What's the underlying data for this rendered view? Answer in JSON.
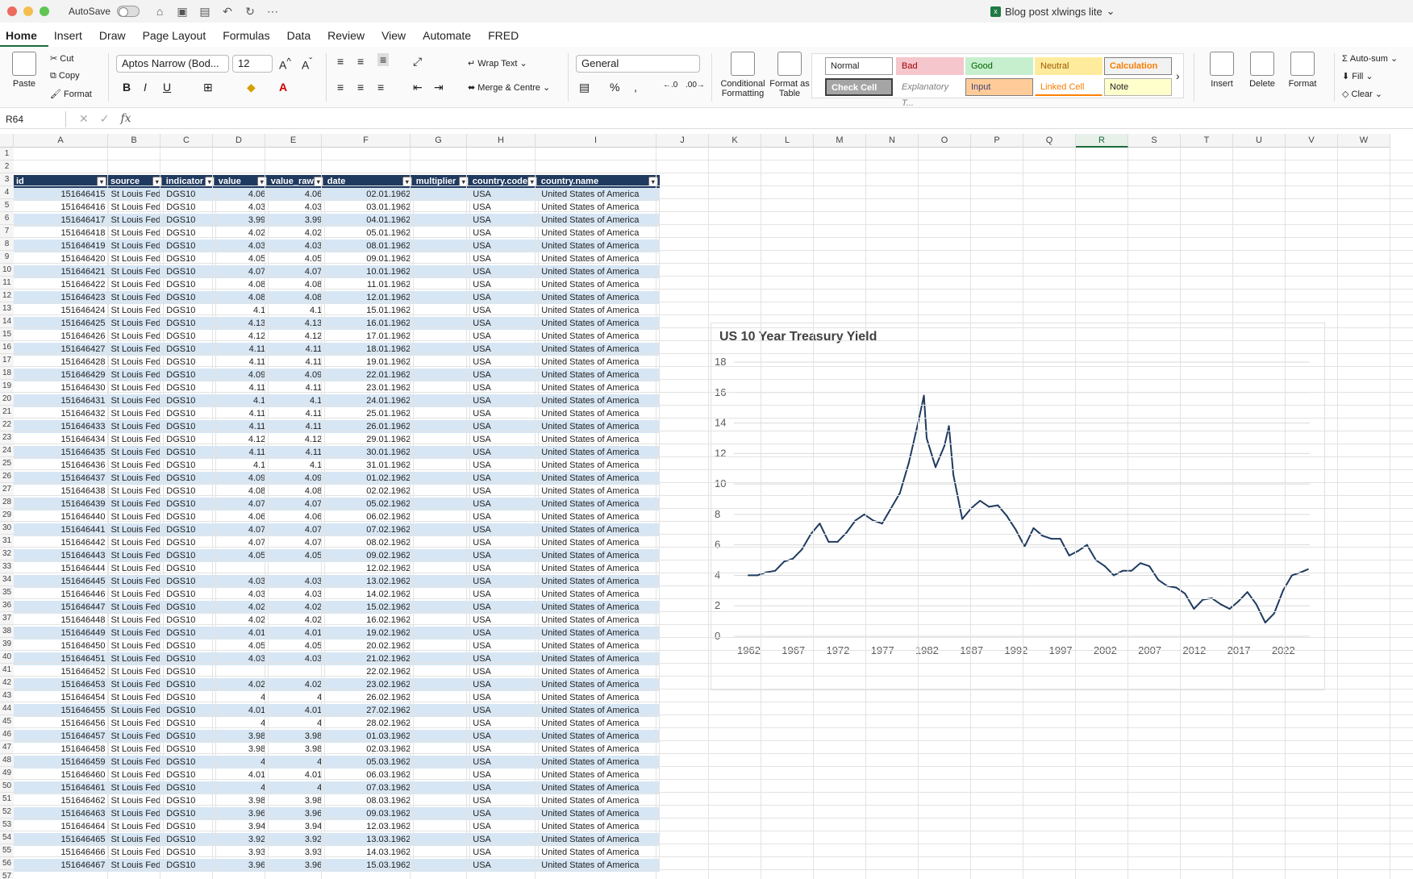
{
  "window": {
    "autosave_label": "AutoSave",
    "doc_title": "Blog post xlwings lite"
  },
  "tabs": [
    "Home",
    "Insert",
    "Draw",
    "Page Layout",
    "Formulas",
    "Data",
    "Review",
    "View",
    "Automate",
    "FRED"
  ],
  "ribbon": {
    "paste": "Paste",
    "cut": "Cut",
    "copy": "Copy",
    "format_painter": "Format",
    "font_name": "Aptos Narrow (Bod...",
    "font_size": "12",
    "wrap_text": "Wrap Text",
    "merge_center": "Merge & Centre",
    "number_format": "General",
    "conditional_formatting": "Conditional Formatting",
    "format_as_table": "Format as Table",
    "styles": [
      "Normal",
      "Bad",
      "Good",
      "Neutral",
      "Calculation",
      "Check Cell",
      "Explanatory T...",
      "Input",
      "Linked Cell",
      "Note"
    ],
    "insert": "Insert",
    "delete": "Delete",
    "format": "Format",
    "autosum": "Auto-sum",
    "fill": "Fill",
    "clear": "Clear"
  },
  "formula_bar": {
    "name_box": "R64",
    "fx": "fx"
  },
  "columns": [
    "A",
    "B",
    "C",
    "D",
    "E",
    "F",
    "G",
    "H",
    "I",
    "J",
    "K",
    "L",
    "M",
    "N",
    "O",
    "P",
    "Q",
    "R",
    "S",
    "T",
    "U",
    "V",
    "W"
  ],
  "selected_column": "R",
  "rows": [
    "1",
    "2",
    "3",
    "4",
    "5",
    "6",
    "7",
    "8",
    "9",
    "10",
    "11",
    "12",
    "13",
    "14",
    "15",
    "16",
    "17",
    "18",
    "19",
    "20",
    "21",
    "22",
    "23",
    "24",
    "25",
    "26",
    "27",
    "28",
    "29",
    "30",
    "31",
    "32",
    "33",
    "34",
    "35",
    "36",
    "37",
    "38",
    "39",
    "40",
    "41",
    "42",
    "43",
    "44",
    "45",
    "46",
    "47",
    "48",
    "49",
    "50",
    "51",
    "52",
    "53",
    "54",
    "55",
    "56",
    "57"
  ],
  "table": {
    "headers": [
      "id",
      "source",
      "indicator",
      "value",
      "value_raw",
      "date",
      "multiplier",
      "country.code",
      "country.name"
    ],
    "rows": [
      [
        "151646415",
        "St Louis Fed",
        "DGS10",
        "4.06",
        "4.06",
        "02.01.1962",
        "",
        "USA",
        "United States of America"
      ],
      [
        "151646416",
        "St Louis Fed",
        "DGS10",
        "4.03",
        "4.03",
        "03.01.1962",
        "",
        "USA",
        "United States of America"
      ],
      [
        "151646417",
        "St Louis Fed",
        "DGS10",
        "3.99",
        "3.99",
        "04.01.1962",
        "",
        "USA",
        "United States of America"
      ],
      [
        "151646418",
        "St Louis Fed",
        "DGS10",
        "4.02",
        "4.02",
        "05.01.1962",
        "",
        "USA",
        "United States of America"
      ],
      [
        "151646419",
        "St Louis Fed",
        "DGS10",
        "4.03",
        "4.03",
        "08.01.1962",
        "",
        "USA",
        "United States of America"
      ],
      [
        "151646420",
        "St Louis Fed",
        "DGS10",
        "4.05",
        "4.05",
        "09.01.1962",
        "",
        "USA",
        "United States of America"
      ],
      [
        "151646421",
        "St Louis Fed",
        "DGS10",
        "4.07",
        "4.07",
        "10.01.1962",
        "",
        "USA",
        "United States of America"
      ],
      [
        "151646422",
        "St Louis Fed",
        "DGS10",
        "4.08",
        "4.08",
        "11.01.1962",
        "",
        "USA",
        "United States of America"
      ],
      [
        "151646423",
        "St Louis Fed",
        "DGS10",
        "4.08",
        "4.08",
        "12.01.1962",
        "",
        "USA",
        "United States of America"
      ],
      [
        "151646424",
        "St Louis Fed",
        "DGS10",
        "4.1",
        "4.1",
        "15.01.1962",
        "",
        "USA",
        "United States of America"
      ],
      [
        "151646425",
        "St Louis Fed",
        "DGS10",
        "4.13",
        "4.13",
        "16.01.1962",
        "",
        "USA",
        "United States of America"
      ],
      [
        "151646426",
        "St Louis Fed",
        "DGS10",
        "4.12",
        "4.12",
        "17.01.1962",
        "",
        "USA",
        "United States of America"
      ],
      [
        "151646427",
        "St Louis Fed",
        "DGS10",
        "4.11",
        "4.11",
        "18.01.1962",
        "",
        "USA",
        "United States of America"
      ],
      [
        "151646428",
        "St Louis Fed",
        "DGS10",
        "4.11",
        "4.11",
        "19.01.1962",
        "",
        "USA",
        "United States of America"
      ],
      [
        "151646429",
        "St Louis Fed",
        "DGS10",
        "4.09",
        "4.09",
        "22.01.1962",
        "",
        "USA",
        "United States of America"
      ],
      [
        "151646430",
        "St Louis Fed",
        "DGS10",
        "4.11",
        "4.11",
        "23.01.1962",
        "",
        "USA",
        "United States of America"
      ],
      [
        "151646431",
        "St Louis Fed",
        "DGS10",
        "4.1",
        "4.1",
        "24.01.1962",
        "",
        "USA",
        "United States of America"
      ],
      [
        "151646432",
        "St Louis Fed",
        "DGS10",
        "4.11",
        "4.11",
        "25.01.1962",
        "",
        "USA",
        "United States of America"
      ],
      [
        "151646433",
        "St Louis Fed",
        "DGS10",
        "4.11",
        "4.11",
        "26.01.1962",
        "",
        "USA",
        "United States of America"
      ],
      [
        "151646434",
        "St Louis Fed",
        "DGS10",
        "4.12",
        "4.12",
        "29.01.1962",
        "",
        "USA",
        "United States of America"
      ],
      [
        "151646435",
        "St Louis Fed",
        "DGS10",
        "4.11",
        "4.11",
        "30.01.1962",
        "",
        "USA",
        "United States of America"
      ],
      [
        "151646436",
        "St Louis Fed",
        "DGS10",
        "4.1",
        "4.1",
        "31.01.1962",
        "",
        "USA",
        "United States of America"
      ],
      [
        "151646437",
        "St Louis Fed",
        "DGS10",
        "4.09",
        "4.09",
        "01.02.1962",
        "",
        "USA",
        "United States of America"
      ],
      [
        "151646438",
        "St Louis Fed",
        "DGS10",
        "4.08",
        "4.08",
        "02.02.1962",
        "",
        "USA",
        "United States of America"
      ],
      [
        "151646439",
        "St Louis Fed",
        "DGS10",
        "4.07",
        "4.07",
        "05.02.1962",
        "",
        "USA",
        "United States of America"
      ],
      [
        "151646440",
        "St Louis Fed",
        "DGS10",
        "4.06",
        "4.06",
        "06.02.1962",
        "",
        "USA",
        "United States of America"
      ],
      [
        "151646441",
        "St Louis Fed",
        "DGS10",
        "4.07",
        "4.07",
        "07.02.1962",
        "",
        "USA",
        "United States of America"
      ],
      [
        "151646442",
        "St Louis Fed",
        "DGS10",
        "4.07",
        "4.07",
        "08.02.1962",
        "",
        "USA",
        "United States of America"
      ],
      [
        "151646443",
        "St Louis Fed",
        "DGS10",
        "4.05",
        "4.05",
        "09.02.1962",
        "",
        "USA",
        "United States of America"
      ],
      [
        "151646444",
        "St Louis Fed",
        "DGS10",
        "",
        "",
        "12.02.1962",
        "",
        "USA",
        "United States of America"
      ],
      [
        "151646445",
        "St Louis Fed",
        "DGS10",
        "4.03",
        "4.03",
        "13.02.1962",
        "",
        "USA",
        "United States of America"
      ],
      [
        "151646446",
        "St Louis Fed",
        "DGS10",
        "4.03",
        "4.03",
        "14.02.1962",
        "",
        "USA",
        "United States of America"
      ],
      [
        "151646447",
        "St Louis Fed",
        "DGS10",
        "4.02",
        "4.02",
        "15.02.1962",
        "",
        "USA",
        "United States of America"
      ],
      [
        "151646448",
        "St Louis Fed",
        "DGS10",
        "4.02",
        "4.02",
        "16.02.1962",
        "",
        "USA",
        "United States of America"
      ],
      [
        "151646449",
        "St Louis Fed",
        "DGS10",
        "4.01",
        "4.01",
        "19.02.1962",
        "",
        "USA",
        "United States of America"
      ],
      [
        "151646450",
        "St Louis Fed",
        "DGS10",
        "4.05",
        "4.05",
        "20.02.1962",
        "",
        "USA",
        "United States of America"
      ],
      [
        "151646451",
        "St Louis Fed",
        "DGS10",
        "4.03",
        "4.03",
        "21.02.1962",
        "",
        "USA",
        "United States of America"
      ],
      [
        "151646452",
        "St Louis Fed",
        "DGS10",
        "",
        "",
        "22.02.1962",
        "",
        "USA",
        "United States of America"
      ],
      [
        "151646453",
        "St Louis Fed",
        "DGS10",
        "4.02",
        "4.02",
        "23.02.1962",
        "",
        "USA",
        "United States of America"
      ],
      [
        "151646454",
        "St Louis Fed",
        "DGS10",
        "4",
        "4",
        "26.02.1962",
        "",
        "USA",
        "United States of America"
      ],
      [
        "151646455",
        "St Louis Fed",
        "DGS10",
        "4.01",
        "4.01",
        "27.02.1962",
        "",
        "USA",
        "United States of America"
      ],
      [
        "151646456",
        "St Louis Fed",
        "DGS10",
        "4",
        "4",
        "28.02.1962",
        "",
        "USA",
        "United States of America"
      ],
      [
        "151646457",
        "St Louis Fed",
        "DGS10",
        "3.98",
        "3.98",
        "01.03.1962",
        "",
        "USA",
        "United States of America"
      ],
      [
        "151646458",
        "St Louis Fed",
        "DGS10",
        "3.98",
        "3.98",
        "02.03.1962",
        "",
        "USA",
        "United States of America"
      ],
      [
        "151646459",
        "St Louis Fed",
        "DGS10",
        "4",
        "4",
        "05.03.1962",
        "",
        "USA",
        "United States of America"
      ],
      [
        "151646460",
        "St Louis Fed",
        "DGS10",
        "4.01",
        "4.01",
        "06.03.1962",
        "",
        "USA",
        "United States of America"
      ],
      [
        "151646461",
        "St Louis Fed",
        "DGS10",
        "4",
        "4",
        "07.03.1962",
        "",
        "USA",
        "United States of America"
      ],
      [
        "151646462",
        "St Louis Fed",
        "DGS10",
        "3.98",
        "3.98",
        "08.03.1962",
        "",
        "USA",
        "United States of America"
      ],
      [
        "151646463",
        "St Louis Fed",
        "DGS10",
        "3.96",
        "3.96",
        "09.03.1962",
        "",
        "USA",
        "United States of America"
      ],
      [
        "151646464",
        "St Louis Fed",
        "DGS10",
        "3.94",
        "3.94",
        "12.03.1962",
        "",
        "USA",
        "United States of America"
      ],
      [
        "151646465",
        "St Louis Fed",
        "DGS10",
        "3.92",
        "3.92",
        "13.03.1962",
        "",
        "USA",
        "United States of America"
      ],
      [
        "151646466",
        "St Louis Fed",
        "DGS10",
        "3.93",
        "3.93",
        "14.03.1962",
        "",
        "USA",
        "United States of America"
      ],
      [
        "151646467",
        "St Louis Fed",
        "DGS10",
        "3.96",
        "3.96",
        "15.03.1962",
        "",
        "USA",
        "United States of America"
      ]
    ]
  },
  "chart_data": {
    "type": "line",
    "title": "US 10 Year Treasury Yield",
    "xlabel": "",
    "ylabel": "",
    "ylim": [
      0,
      18
    ],
    "yticks": [
      0,
      2,
      4,
      6,
      8,
      10,
      12,
      14,
      16,
      18
    ],
    "xticks": [
      "1962",
      "1967",
      "1972",
      "1977",
      "1982",
      "1987",
      "1992",
      "1997",
      "2002",
      "2007",
      "2012",
      "2017",
      "2022"
    ],
    "xlim": [
      1962,
      2025
    ],
    "grid": true,
    "color": "#1f3a5f",
    "x": [
      1962,
      1963,
      1964,
      1965,
      1966,
      1967,
      1968,
      1969,
      1970,
      1971,
      1972,
      1973,
      1974,
      1975,
      1976,
      1977,
      1978,
      1979,
      1980,
      1981,
      1981.7,
      1982,
      1983,
      1984,
      1984.5,
      1985,
      1986,
      1987,
      1988,
      1989,
      1990,
      1991,
      1992,
      1993,
      1994,
      1995,
      1996,
      1997,
      1998,
      1999,
      2000,
      2001,
      2002,
      2003,
      2004,
      2005,
      2006,
      2007,
      2008,
      2009,
      2010,
      2011,
      2012,
      2013,
      2014,
      2015,
      2016,
      2017,
      2018,
      2019,
      2020,
      2021,
      2022,
      2023,
      2024,
      2024.8
    ],
    "y": [
      4.0,
      4.0,
      4.2,
      4.3,
      4.9,
      5.1,
      5.7,
      6.7,
      7.4,
      6.2,
      6.2,
      6.8,
      7.6,
      8.0,
      7.6,
      7.4,
      8.4,
      9.4,
      11.4,
      13.9,
      15.8,
      13.0,
      11.1,
      12.5,
      13.8,
      10.6,
      7.7,
      8.4,
      8.9,
      8.5,
      8.6,
      7.9,
      7.0,
      5.9,
      7.1,
      6.6,
      6.4,
      6.4,
      5.3,
      5.6,
      6.0,
      5.0,
      4.6,
      4.0,
      4.3,
      4.3,
      4.8,
      4.6,
      3.7,
      3.3,
      3.2,
      2.8,
      1.8,
      2.4,
      2.5,
      2.1,
      1.8,
      2.3,
      2.9,
      2.1,
      0.9,
      1.5,
      3.0,
      4.0,
      4.2,
      4.4
    ]
  }
}
